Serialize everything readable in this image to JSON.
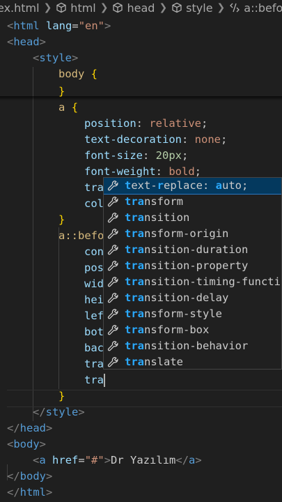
{
  "breadcrumb": {
    "file": "ex.html",
    "items": [
      "html",
      "head",
      "style",
      "a::before"
    ]
  },
  "code": {
    "line1": {
      "open": "<",
      "tag": "html",
      "attr": "lang",
      "eq": "=",
      "val": "\"en\"",
      "close": ">"
    },
    "line2": {
      "open": "<",
      "tag": "head",
      "close": ">"
    },
    "line3": {
      "open": "<",
      "tag": "style",
      "close": ">"
    },
    "line4": {
      "sel": "body",
      "brace": "{"
    },
    "line5": {
      "brace": "}"
    },
    "line6": {
      "sel": "a",
      "brace": "{"
    },
    "line7": {
      "prop": "position",
      "colon": ": ",
      "val": "relative",
      "semi": ";"
    },
    "line8": {
      "prop": "text-decoration",
      "colon": ": ",
      "val": "none",
      "semi": ";"
    },
    "line9": {
      "prop": "font-size",
      "colon": ": ",
      "val": "20px",
      "semi": ";"
    },
    "line10": {
      "prop": "font-weight",
      "colon": ": ",
      "val": "bold",
      "semi": ";"
    },
    "line11": {
      "prop": "tra"
    },
    "line12": {
      "prop": "col"
    },
    "line13": {
      "brace": "}"
    },
    "line14": {
      "sel": "a::befo"
    },
    "line15": {
      "prop": "con"
    },
    "line16": {
      "prop": "pos"
    },
    "line17": {
      "prop": "wid"
    },
    "line18": {
      "prop": "hei"
    },
    "line19": {
      "prop": "lef"
    },
    "line20": {
      "prop": "bot"
    },
    "line21": {
      "prop": "bac"
    },
    "line22": {
      "prop": "tra"
    },
    "line23": {
      "prop": "tra"
    },
    "line24": {
      "brace": "}"
    },
    "line25": {
      "open": "</",
      "tag": "style",
      "close": ">"
    },
    "line26": {
      "open": "</",
      "tag": "head",
      "close": ">"
    },
    "line27": {
      "open": "<",
      "tag": "body",
      "close": ">"
    },
    "line28": {
      "open": "<",
      "tag": "a",
      "attr": "href",
      "eq": "=",
      "val": "\"#\"",
      "close": ">",
      "text": "Dr Yazılım",
      "open2": "</",
      "tag2": "a",
      "close2": ">"
    },
    "line29": {
      "open": "</",
      "tag": "body",
      "close": ">"
    },
    "line30": {
      "open": "</",
      "tag": "html",
      "close": ">"
    }
  },
  "suggestions": [
    {
      "hl1": "t",
      "mid1": "ext-",
      "hl2": "r",
      "mid2": "eplace: ",
      "hl3": "a",
      "rest": "uto;",
      "selected": true
    },
    {
      "hl": "tra",
      "rest": "nsform"
    },
    {
      "hl": "tra",
      "rest": "nsition"
    },
    {
      "hl": "tra",
      "rest": "nsform-origin"
    },
    {
      "hl": "tra",
      "rest": "nsition-duration"
    },
    {
      "hl": "tra",
      "rest": "nsition-property"
    },
    {
      "hl": "tra",
      "rest": "nsition-timing-functio"
    },
    {
      "hl": "tra",
      "rest": "nsition-delay"
    },
    {
      "hl": "tra",
      "rest": "nsform-style"
    },
    {
      "hl": "tra",
      "rest": "nsform-box"
    },
    {
      "hl": "tra",
      "rest": "nsition-behavior"
    },
    {
      "hl": "tra",
      "rest": "nslate"
    }
  ],
  "icons": {
    "breadcrumb_item": "cube-icon",
    "suggestion": "wrench-icon",
    "style_item": "style-icon"
  },
  "colors": {
    "background": "#1f1f1f",
    "tag": "#569cd6",
    "property": "#9cdcfe",
    "string": "#ce9178",
    "selector": "#d7ba7d",
    "match": "#2aaaff",
    "selected_bg": "#04395e"
  }
}
